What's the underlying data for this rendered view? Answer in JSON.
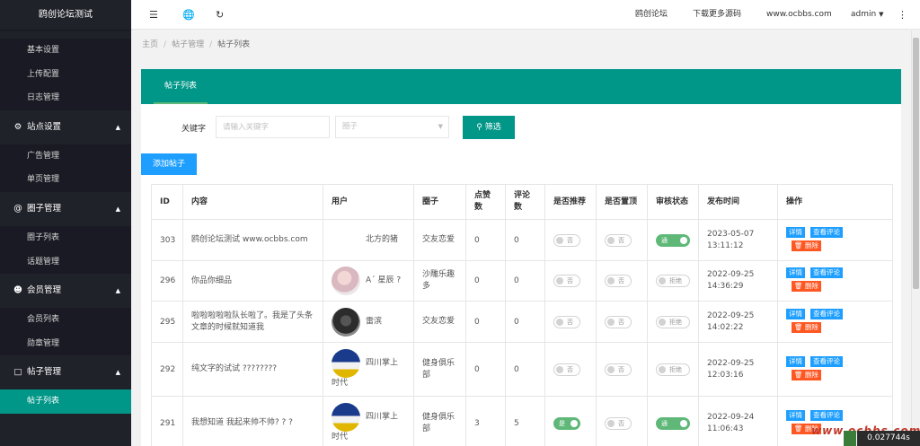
{
  "sidebar": {
    "logo": "鸥创论坛测试",
    "top_items": [
      "基本设置",
      "上传配置",
      "日志管理"
    ],
    "groups": [
      {
        "icon": "gear-icon",
        "glyph": "⚙",
        "label": "站点设置",
        "items": [
          "广告管理",
          "单页管理"
        ]
      },
      {
        "icon": "at-icon",
        "glyph": "@",
        "label": "圈子管理",
        "items": [
          "圈子列表",
          "话题管理"
        ]
      },
      {
        "icon": "user-icon",
        "glyph": "👤",
        "label": "会员管理",
        "items": [
          "会员列表",
          "勋章管理"
        ]
      },
      {
        "icon": "cart-icon",
        "glyph": "🛒",
        "label": "帖子管理",
        "items": [
          "帖子列表"
        ]
      }
    ],
    "active_item": "帖子列表"
  },
  "header": {
    "icons": [
      "menu-icon",
      "globe-icon",
      "refresh-icon"
    ],
    "links": [
      "鸥创论坛",
      "下载更多源码",
      "www.ocbbs.com"
    ],
    "user": "admin"
  },
  "breadcrumb": [
    "主页",
    "帖子管理",
    "帖子列表"
  ],
  "card": {
    "tab": "帖子列表",
    "filter": {
      "keyword_label": "关键字",
      "keyword_placeholder": "请输入关键字",
      "circle_placeholder": "圈子",
      "filter_button": "筛选"
    },
    "add_button": "添加帖子"
  },
  "table": {
    "headers": [
      "ID",
      "内容",
      "用户",
      "圈子",
      "点赞数",
      "评论数",
      "是否推荐",
      "是否置顶",
      "审核状态",
      "发布时间",
      "操作"
    ],
    "op_labels": {
      "detail": "详情",
      "comments": "查看评论",
      "delete": "删除"
    },
    "rows": [
      {
        "id": "303",
        "content": "鸥创论坛测试 www.ocbbs.com",
        "user": "北方的猪",
        "avatar": "",
        "circle": "交友恋爱",
        "likes": "0",
        "comments": "0",
        "recommend": "否",
        "recommend_on": false,
        "top": "否",
        "top_on": false,
        "review": "通",
        "review_on": true,
        "date": "2023-05-07",
        "time": "13:11:12"
      },
      {
        "id": "296",
        "content": "你品你细品",
        "user": "A´ 星辰 ?",
        "avatar": "a1",
        "circle": "沙雕乐趣多",
        "likes": "0",
        "comments": "0",
        "recommend": "否",
        "recommend_on": false,
        "top": "否",
        "top_on": false,
        "review": "拒绝",
        "review_on": false,
        "date": "2022-09-25",
        "time": "14:36:29"
      },
      {
        "id": "295",
        "content": "啦啦啦啦啦队长啦了。我是了头条文章的时候就知道我",
        "user": "雷滨",
        "avatar": "a2",
        "circle": "交友恋爱",
        "likes": "0",
        "comments": "0",
        "recommend": "否",
        "recommend_on": false,
        "top": "否",
        "top_on": false,
        "review": "拒绝",
        "review_on": false,
        "date": "2022-09-25",
        "time": "14:02:22"
      },
      {
        "id": "292",
        "content": "纯文字的试试 ????????",
        "user": "四川掌上时代",
        "avatar": "a3",
        "circle": "健身俱乐部",
        "likes": "0",
        "comments": "0",
        "recommend": "否",
        "recommend_on": false,
        "top": "否",
        "top_on": false,
        "review": "拒绝",
        "review_on": false,
        "date": "2022-09-25",
        "time": "12:03:16"
      },
      {
        "id": "291",
        "content": "我想知道 我起来帅不帅? ? ?",
        "user": "四川掌上时代",
        "avatar": "a3",
        "circle": "健身俱乐部",
        "likes": "3",
        "comments": "5",
        "recommend": "是",
        "recommend_on": true,
        "top": "否",
        "top_on": false,
        "review": "通",
        "review_on": true,
        "date": "2022-09-24",
        "time": "11:06:43"
      }
    ]
  },
  "watermark": "www.ocbbs.com",
  "timer": "0.027744s"
}
